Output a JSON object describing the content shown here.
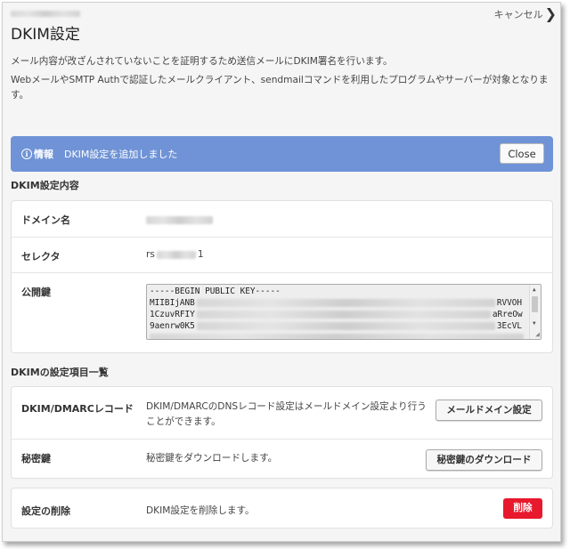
{
  "header": {
    "cancel_label": "キャンセル",
    "title": "DKIM設定"
  },
  "description": {
    "line1": "メール内容が改ざんされていないことを証明するため送信メールにDKIM署名を行います。",
    "line2": "WebメールやSMTP Authで認証したメールクライアント、sendmailコマンドを利用したプログラムやサーバーが対象となります。"
  },
  "info": {
    "label": "情報",
    "message": "DKIM設定を追加しました",
    "close_label": "Close",
    "color": "#6f93d6"
  },
  "dkim_details": {
    "heading": "DKIM設定内容",
    "domain_label": "ドメイン名",
    "selector_label": "セレクタ",
    "selector_prefix": "rs",
    "selector_suffix": "1",
    "public_key_label": "公開鍵",
    "key_lines": [
      {
        "lead": "-----BEGIN PUBLIC KEY-----",
        "tail": ""
      },
      {
        "lead": "MIIBIjANB",
        "tail": "RVVOH"
      },
      {
        "lead": "1CzuvRFIY",
        "tail": "aRreOw"
      },
      {
        "lead": "9aenrw0K5",
        "tail": "3EcVL"
      }
    ]
  },
  "settings": {
    "heading": "DKIMの設定項目一覧",
    "dmarc_label": "DKIM/DMARCレコード",
    "dmarc_desc": "DKIM/DMARCのDNSレコード設定はメールドメイン設定より行うことができます。",
    "dmarc_button": "メールドメイン設定",
    "private_key_label": "秘密鍵",
    "private_key_desc": "秘密鍵をダウンロードします。",
    "private_key_button": "秘密鍵のダウンロード"
  },
  "delete": {
    "label": "設定の削除",
    "desc": "DKIM設定を削除します。",
    "button": "削除",
    "color": "#e8192c"
  }
}
